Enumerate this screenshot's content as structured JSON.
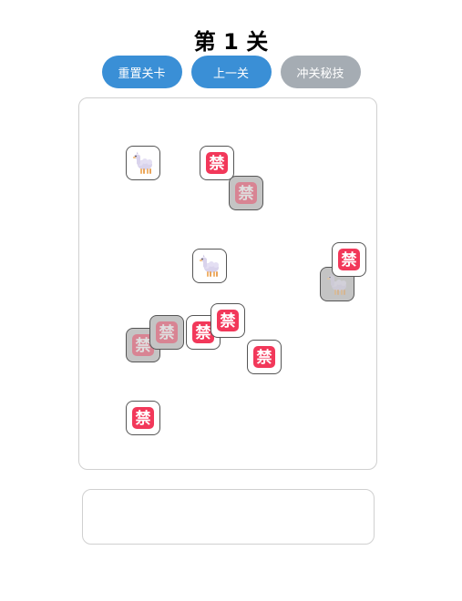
{
  "title": "第 1 关",
  "buttons": {
    "reset": "重置关卡",
    "prev": "上一关",
    "cheat": "冲关秘技"
  },
  "icons": {
    "forbidden_char": "禁",
    "alpaca": "llama-icon"
  },
  "colors": {
    "blue_button": "#3a8fd6",
    "gray_button": "#a5acb3",
    "forbidden_red": "#f2385a",
    "blocked_tile": "#c4c4c4"
  },
  "board_tiles": [
    {
      "kind": "llama",
      "blocked": false
    },
    {
      "kind": "forbidden",
      "blocked": false
    },
    {
      "kind": "forbidden",
      "blocked": true
    },
    {
      "kind": "llama",
      "blocked": false
    },
    {
      "kind": "llama",
      "blocked": true
    },
    {
      "kind": "forbidden",
      "blocked": false
    },
    {
      "kind": "forbidden",
      "blocked": true
    },
    {
      "kind": "forbidden",
      "blocked": false
    },
    {
      "kind": "forbidden",
      "blocked": true
    },
    {
      "kind": "forbidden",
      "blocked": false
    },
    {
      "kind": "forbidden",
      "blocked": false
    },
    {
      "kind": "forbidden",
      "blocked": false
    }
  ],
  "slot_tiles": []
}
